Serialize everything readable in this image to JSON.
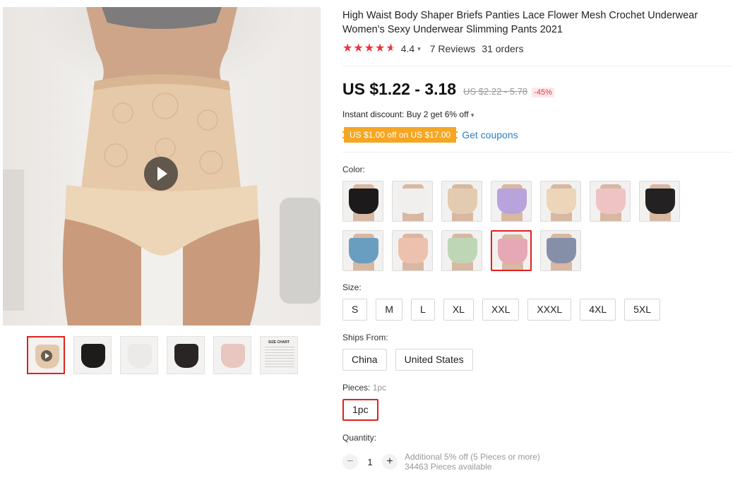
{
  "gallery": {
    "thumbnails": [
      {
        "name": "video-thumb",
        "color": "#e3c9ac",
        "video": true
      },
      {
        "name": "black-lace-thumb",
        "color": "#1e1b1b"
      },
      {
        "name": "white-thumb",
        "color": "#eceae8"
      },
      {
        "name": "back-view-thumb",
        "color": "#2a2525"
      },
      {
        "name": "colors-stack-thumb",
        "color": "#e7c7c0"
      },
      {
        "name": "size-chart-thumb",
        "color": "#ffffff",
        "chart_text": "SIZE CHART"
      }
    ]
  },
  "product": {
    "title": "High Waist Body Shaper Briefs Panties Lace Flower Mesh Crochet Underwear Women's Sexy Underwear Slimming Pants 2021",
    "rating": "4.4",
    "stars_level": 0.88,
    "reviews": "7 Reviews",
    "orders": "31 orders",
    "price": "US $1.22 - 3.18",
    "old_price": "US $2.22 - 5.78",
    "discount": "-45%",
    "instant_discount": "Instant discount: Buy 2 get 6% off",
    "coupon_badge": "US $1.00 off on US $17.00",
    "get_coupons": "Get coupons"
  },
  "color": {
    "label": "Color:",
    "swatches": [
      {
        "name": "black-lace",
        "color": "#1c1a1a"
      },
      {
        "name": "white",
        "color": "#f1efee"
      },
      {
        "name": "beige",
        "color": "#e3cbb1"
      },
      {
        "name": "purple",
        "color": "#b9a3dc"
      },
      {
        "name": "skin",
        "color": "#ecd5b8"
      },
      {
        "name": "pink",
        "color": "#efc3c3"
      },
      {
        "name": "black",
        "color": "#232121"
      },
      {
        "name": "blue",
        "color": "#6a9ec0"
      },
      {
        "name": "peach",
        "color": "#ecc1ad"
      },
      {
        "name": "mint",
        "color": "#bfd6b6"
      },
      {
        "name": "rose-pink",
        "color": "#e6a8b4"
      },
      {
        "name": "gray-blue",
        "color": "#8590a8"
      }
    ],
    "selected_index": 10
  },
  "size": {
    "label": "Size:",
    "options": [
      "S",
      "M",
      "L",
      "XL",
      "XXL",
      "XXXL",
      "4XL",
      "5XL"
    ]
  },
  "ships_from": {
    "label": "Ships From:",
    "options": [
      "China",
      "United States"
    ]
  },
  "pieces": {
    "label": "Pieces:",
    "value": "1pc",
    "options": [
      "1pc"
    ]
  },
  "quantity": {
    "label": "Quantity:",
    "minus": "−",
    "plus": "+",
    "value": "1",
    "additional": "Additional 5% off (5 Pieces or more)",
    "available": "34463 Pieces available"
  },
  "colors": {
    "accent_red": "#e02020",
    "star_red": "#f0323c",
    "coupon_orange": "#f5a623",
    "link_blue": "#2b7fc2"
  }
}
